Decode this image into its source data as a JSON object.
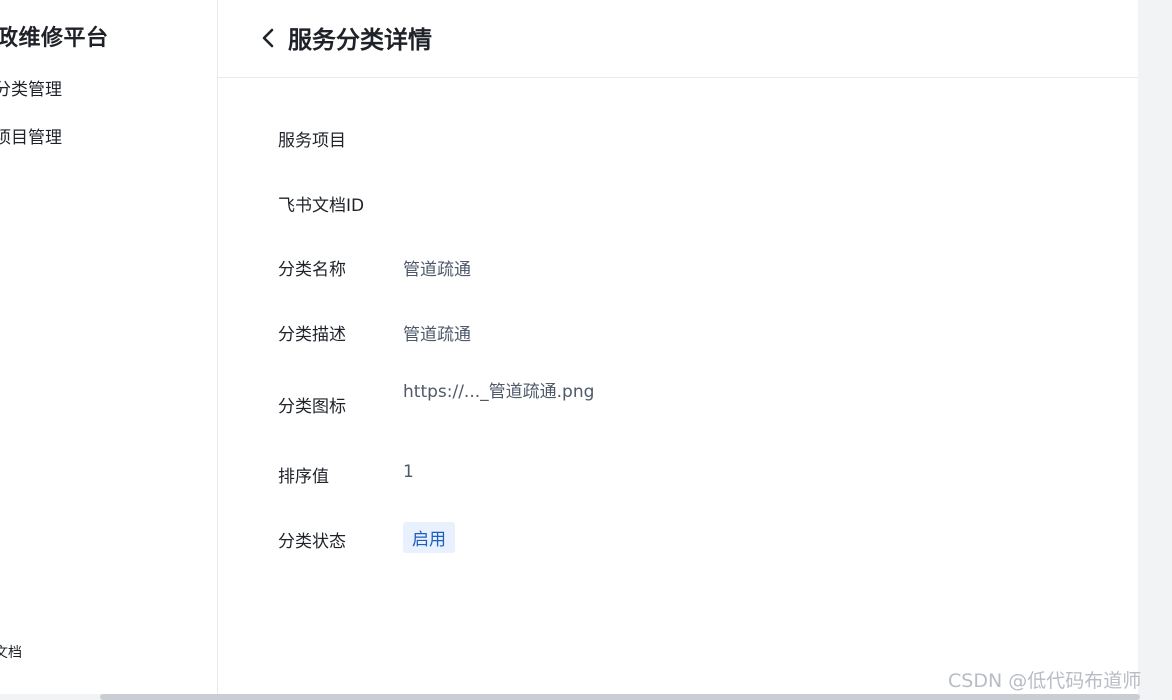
{
  "sidebar": {
    "brand": "政维修平台",
    "items": [
      {
        "label": "分类管理"
      },
      {
        "label": "项目管理"
      }
    ],
    "footer_link": "文档"
  },
  "header": {
    "back_icon": "chevron-left-icon",
    "title": "服务分类详情"
  },
  "details": {
    "service_item": {
      "label": "服务项目",
      "value": ""
    },
    "feishu_doc_id": {
      "label": "飞书文档ID",
      "value": ""
    },
    "category_name": {
      "label": "分类名称",
      "value": "管道疏通"
    },
    "category_desc": {
      "label": "分类描述",
      "value": "管道疏通"
    },
    "category_icon": {
      "label": "分类图标",
      "value": "https://..._管道疏通.png"
    },
    "sort_value": {
      "label": "排序值",
      "value": "1"
    },
    "category_status": {
      "label": "分类状态",
      "value": "启用"
    }
  },
  "watermark": "CSDN @低代码布道师",
  "colors": {
    "status_tag_bg": "#e8f1fd",
    "status_tag_text": "#1d5fbf",
    "divider": "#e8e9eb"
  }
}
